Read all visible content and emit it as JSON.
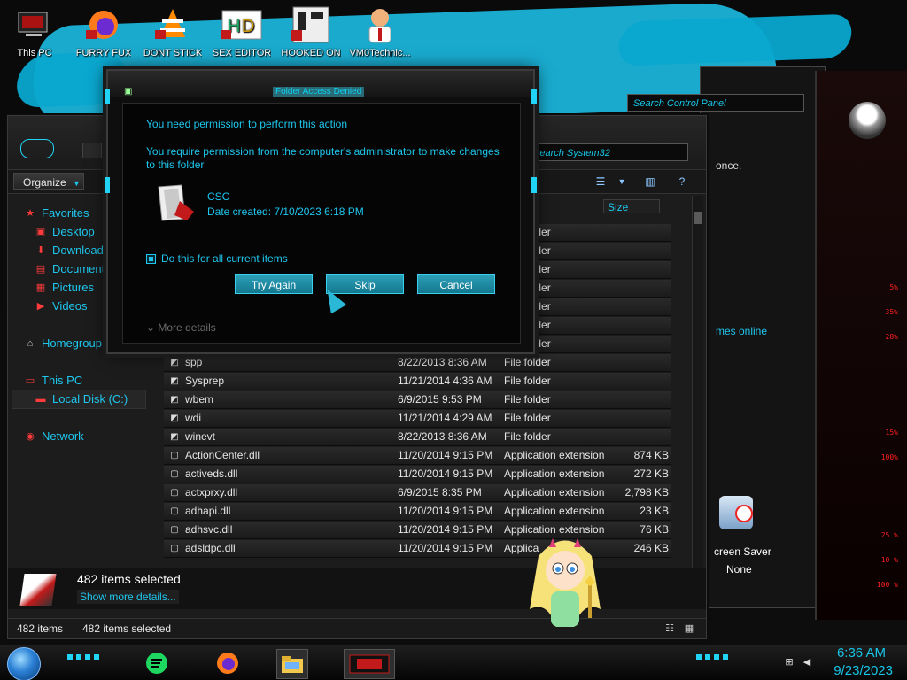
{
  "desktop_icons": [
    {
      "label": "This PC",
      "icon": "computer-icon"
    },
    {
      "label": "FURRY FUX",
      "icon": "firefox-icon"
    },
    {
      "label": "DONT STICK",
      "icon": "vlc-icon"
    },
    {
      "label": "SEX EDITOR",
      "icon": "hex-editor-icon"
    },
    {
      "label": "HOOKED ON",
      "icon": "game-icon"
    },
    {
      "label": "VM0Technic...",
      "icon": "technician-icon"
    }
  ],
  "control_panel": {
    "search_placeholder": "Search Control Panel",
    "snippet_1": "once.",
    "snippet_2": "mes online"
  },
  "explorer": {
    "search_placeholder": "Search System32",
    "toolbar": {
      "organize_label": "Organize"
    },
    "nav": {
      "favorites": "Favorites",
      "desktop": "Desktop",
      "downloads": "Downloads",
      "documents": "Document",
      "pictures": "Pictures",
      "videos": "Videos",
      "homegroup": "Homegroup",
      "this_pc": "This PC",
      "local_disk": "Local Disk (C:)",
      "network": "Network"
    },
    "columns": {
      "size": "Size"
    },
    "hidden_rows_type": "File folder",
    "rows": [
      {
        "name": "spp",
        "date": "8/22/2013 8:36 AM",
        "type": "File folder",
        "size": ""
      },
      {
        "name": "Sysprep",
        "date": "11/21/2014 4:36 AM",
        "type": "File folder",
        "size": ""
      },
      {
        "name": "wbem",
        "date": "6/9/2015 9:53 PM",
        "type": "File folder",
        "size": ""
      },
      {
        "name": "wdi",
        "date": "11/21/2014 4:29 AM",
        "type": "File folder",
        "size": ""
      },
      {
        "name": "winevt",
        "date": "8/22/2013 8:36 AM",
        "type": "File folder",
        "size": ""
      },
      {
        "name": "ActionCenter.dll",
        "date": "11/20/2014 9:15 PM",
        "type": "Application extension",
        "size": "874 KB"
      },
      {
        "name": "activeds.dll",
        "date": "11/20/2014 9:15 PM",
        "type": "Application extension",
        "size": "272 KB"
      },
      {
        "name": "actxprxy.dll",
        "date": "6/9/2015 8:35 PM",
        "type": "Application extension",
        "size": "2,798 KB"
      },
      {
        "name": "adhapi.dll",
        "date": "11/20/2014 9:15 PM",
        "type": "Application extension",
        "size": "23 KB"
      },
      {
        "name": "adhsvc.dll",
        "date": "11/20/2014 9:15 PM",
        "type": "Application extension",
        "size": "76 KB"
      },
      {
        "name": "adsldpc.dll",
        "date": "11/20/2014 9:15 PM",
        "type": "Applica",
        "size": "246 KB"
      }
    ],
    "details": {
      "selected_title": "482 items selected",
      "show_more": "Show more details..."
    },
    "status": {
      "items": "482 items",
      "selected": "482 items selected"
    }
  },
  "dialog": {
    "title": "Folder Access Denied",
    "heading": "You need permission to perform this action",
    "description": "You require permission from the computer's administrator to make changes to this folder",
    "file_name": "CSC",
    "file_date": "Date created: 7/10/2023 6:18 PM",
    "checkbox_label": "Do this for all current items",
    "checkbox_checked": true,
    "buttons": {
      "try_again": "Try Again",
      "skip": "Skip",
      "cancel": "Cancel"
    },
    "more_details": "More details"
  },
  "screensaver": {
    "label": "creen Saver",
    "value": "None"
  },
  "right_panel_stats": [
    "5%",
    "35%",
    "28%",
    "15%",
    "100%",
    "25 %",
    "10 %",
    "100 %"
  ],
  "taskbar": {
    "time": "6:36 AM",
    "date": "9/23/2023"
  },
  "colors": {
    "accent_cyan": "#1ec7ee",
    "alert_red": "#ff2020",
    "button_cyan": "#2b9fb7"
  }
}
